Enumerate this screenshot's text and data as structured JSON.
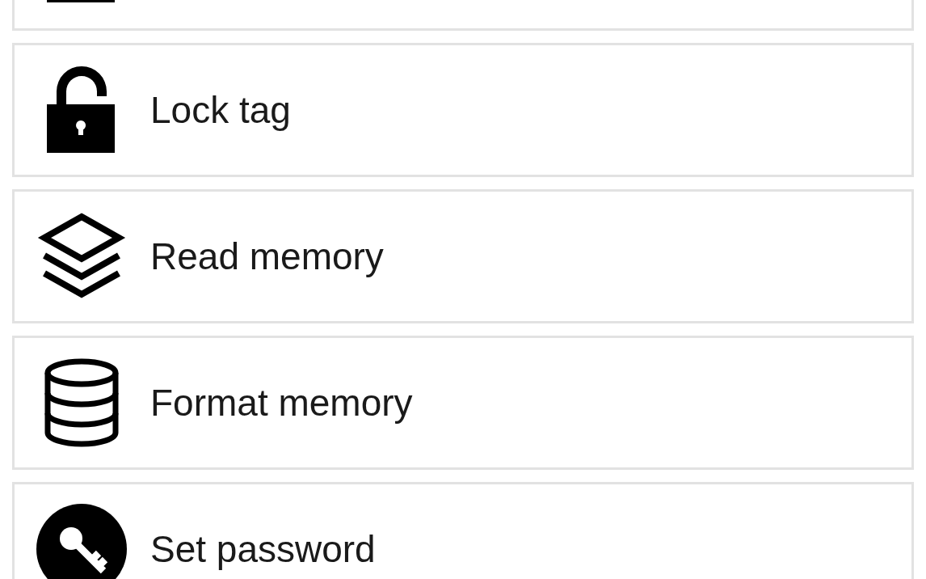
{
  "menu_items": [
    {
      "kind": "cut"
    },
    {
      "kind": "full",
      "label": "Lock tag"
    },
    {
      "kind": "full",
      "label": "Read memory"
    },
    {
      "kind": "full",
      "label": "Format memory"
    },
    {
      "kind": "full",
      "label": "Set password"
    }
  ]
}
